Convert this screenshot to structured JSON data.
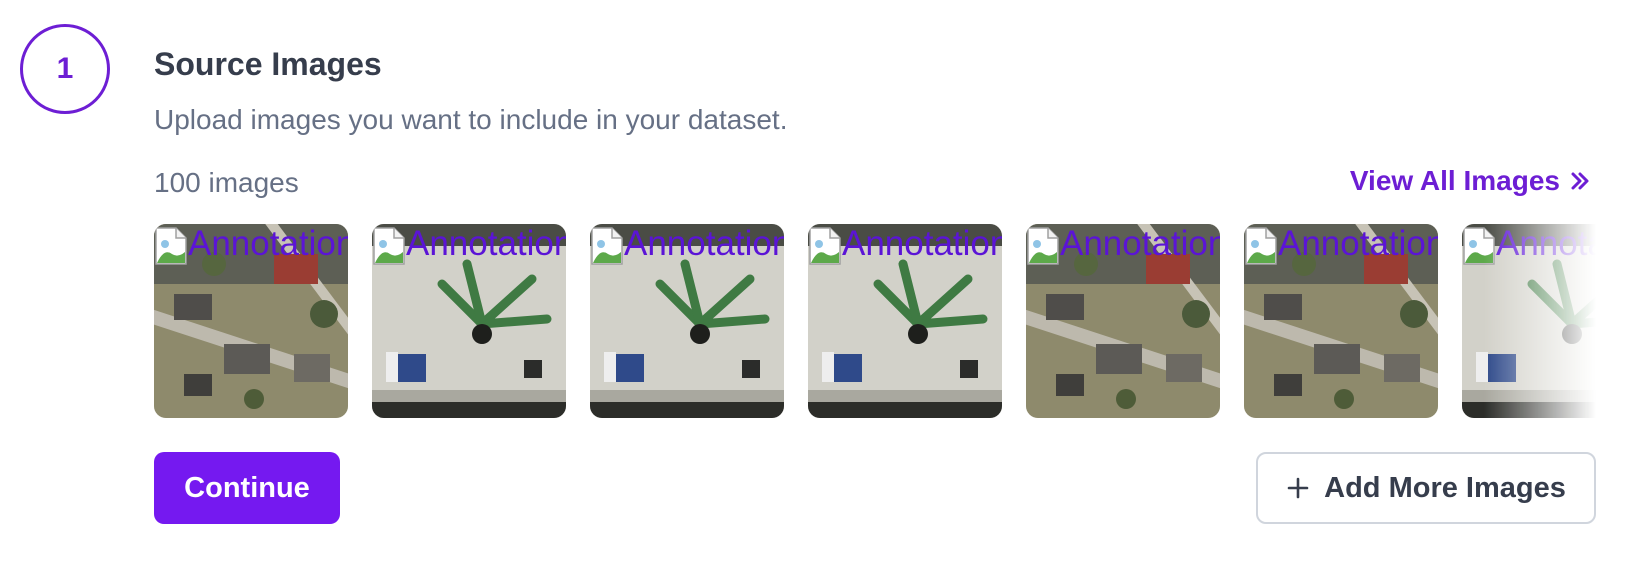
{
  "step": {
    "number": "1"
  },
  "section": {
    "title": "Source Images",
    "subtitle": "Upload images you want to include in your dataset."
  },
  "images": {
    "count_label": "100 images",
    "view_all_label": "View All Images",
    "alt_text": "Annotation",
    "thumbnails": [
      {
        "scene": "aerial-houses"
      },
      {
        "scene": "tabletop-plant"
      },
      {
        "scene": "tabletop-plant"
      },
      {
        "scene": "tabletop-plant"
      },
      {
        "scene": "aerial-houses"
      },
      {
        "scene": "aerial-houses"
      },
      {
        "scene": "tabletop-plant"
      }
    ]
  },
  "actions": {
    "continue_label": "Continue",
    "add_more_label": "Add More Images"
  },
  "colors": {
    "accent": "#6d1ed4",
    "primary_button": "#7519f0",
    "muted_text": "#667085",
    "heading_text": "#363d4c"
  },
  "icons": {
    "view_all": "double-chevron-right-icon",
    "add": "plus-icon",
    "broken_image": "broken-image-icon"
  }
}
